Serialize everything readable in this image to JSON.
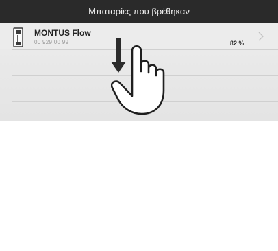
{
  "header": {
    "title": "Μπαταρίες που βρέθηκαν"
  },
  "devices": [
    {
      "name": "MONTUS Flow",
      "code": "00 929 00 99",
      "level": "82 %"
    }
  ],
  "icons": {
    "device": "battery-device-icon",
    "chevron": "chevron-right-icon",
    "gesture": "swipe-down-hand-icon"
  },
  "colors": {
    "header_bg": "#2a2a2a",
    "list_bg": "#ececec"
  }
}
